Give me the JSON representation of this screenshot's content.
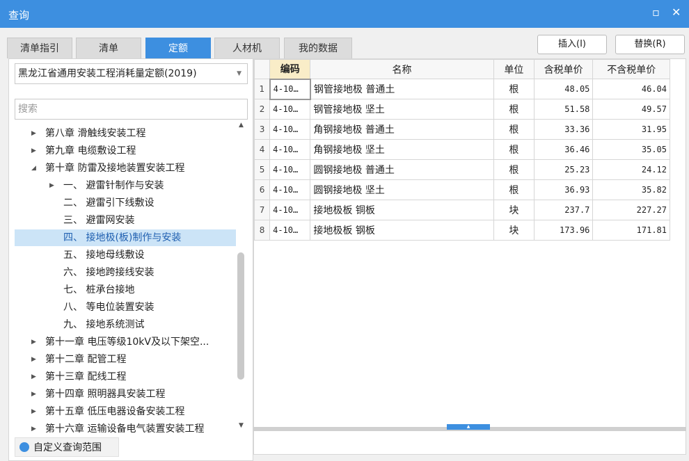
{
  "window": {
    "title": "查询",
    "maximize_icon": "square-icon",
    "close_icon": "x-icon"
  },
  "tabs": [
    "清单指引",
    "清单",
    "定额",
    "人材机",
    "我的数据"
  ],
  "active_tab": "定额",
  "buttons": {
    "insert": "插入(I)",
    "replace": "替换(R)"
  },
  "left": {
    "select_value": "黑龙江省通用安装工程消耗量定额(2019)",
    "search_placeholder": "搜索",
    "custom_scope": "自定义查询范围",
    "tree": [
      "第八章 滑触线安装工程",
      "第九章 电缆敷设工程",
      "第十章 防雷及接地装置安装工程",
      "一、  避雷针制作与安装",
      "二、  避雷引下线敷设",
      "三、  避雷网安装",
      "四、  接地极(板)制作与安装",
      "五、  接地母线敷设",
      "六、  接地跨接线安装",
      "七、  桩承台接地",
      "八、  等电位装置安装",
      "九、  接地系统测试",
      "第十一章 电压等级10kV及以下架空...",
      "第十二章 配管工程",
      "第十三章 配线工程",
      "第十四章 照明器具安装工程",
      "第十五章 低压电器设备安装工程",
      "第十六章 运输设备电气装置安装工程"
    ]
  },
  "table": {
    "headers": {
      "code": "编码",
      "name": "名称",
      "unit": "单位",
      "price_tax": "含税单价",
      "price_notax": "不含税单价"
    },
    "rows": [
      {
        "idx": "1",
        "code": "4-10…",
        "name": "钢管接地极 普通土",
        "unit": "根",
        "tax": "48.05",
        "notax": "46.04"
      },
      {
        "idx": "2",
        "code": "4-10…",
        "name": "钢管接地极 坚土",
        "unit": "根",
        "tax": "51.58",
        "notax": "49.57"
      },
      {
        "idx": "3",
        "code": "4-10…",
        "name": "角钢接地极 普通土",
        "unit": "根",
        "tax": "33.36",
        "notax": "31.95"
      },
      {
        "idx": "4",
        "code": "4-10…",
        "name": "角钢接地极 坚土",
        "unit": "根",
        "tax": "36.46",
        "notax": "35.05"
      },
      {
        "idx": "5",
        "code": "4-10…",
        "name": "圆钢接地极 普通土",
        "unit": "根",
        "tax": "25.23",
        "notax": "24.12"
      },
      {
        "idx": "6",
        "code": "4-10…",
        "name": "圆钢接地极 坚土",
        "unit": "根",
        "tax": "36.93",
        "notax": "35.82"
      },
      {
        "idx": "7",
        "code": "4-10…",
        "name": "接地极板 铜板",
        "unit": "块",
        "tax": "237.7",
        "notax": "227.27"
      },
      {
        "idx": "8",
        "code": "4-10…",
        "name": "接地极板 钢板",
        "unit": "块",
        "tax": "173.96",
        "notax": "171.81"
      }
    ]
  },
  "colors": {
    "accent": "#3d8fe0",
    "selection": "#cce4f7",
    "code_header": "#f9edc8"
  }
}
